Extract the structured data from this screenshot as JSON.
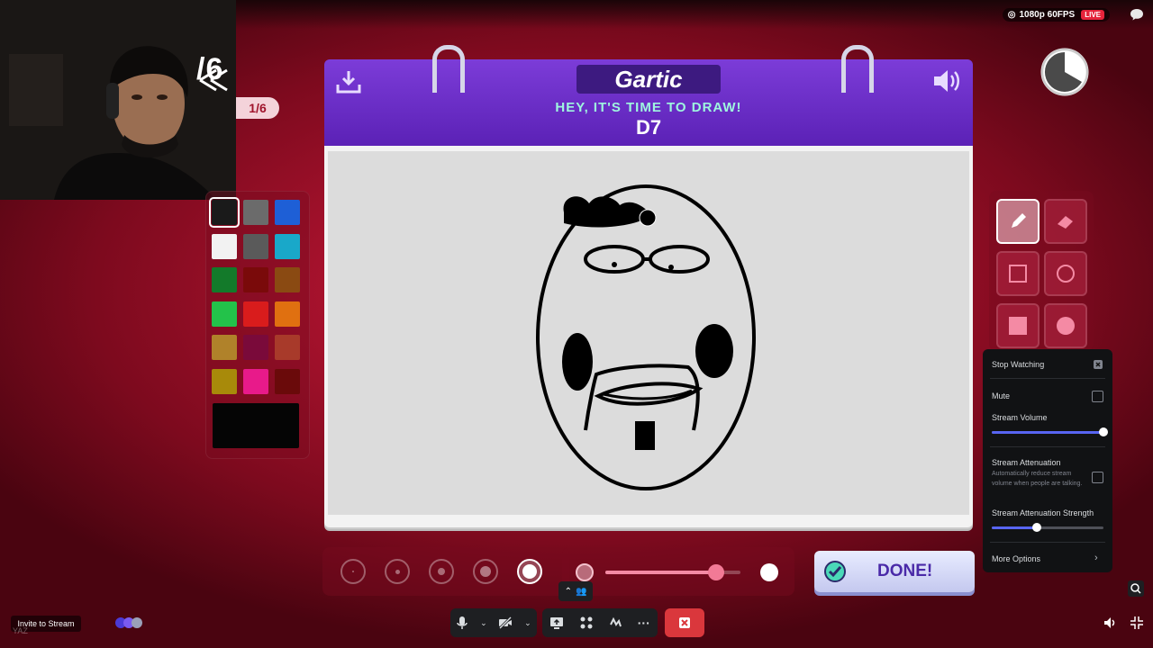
{
  "stream": {
    "quality": "1080p 60FPS",
    "live_badge": "LIVE"
  },
  "game": {
    "round_big": "/6",
    "round_pill": "1/6",
    "logo": "Gartic",
    "prompt": "HEY, IT'S TIME TO DRAW!",
    "word": "D7",
    "done_label": "DONE!",
    "timer_fraction_elapsed": 0.33,
    "selected_tool": "pencil",
    "selected_brush_size": 5,
    "opacity_level": 0.82,
    "selected_color": "#050505",
    "palette": [
      "#1a1a1a",
      "#6b6b6b",
      "#1e5fd6",
      "#f2f2f2",
      "#5a5a5a",
      "#19a8c9",
      "#137a2a",
      "#7a0a0a",
      "#8a4a12",
      "#23c24a",
      "#d91c1c",
      "#e07010",
      "#b0822a",
      "#7a0a3a",
      "#a83a2a",
      "#a88a0a",
      "#e81a8a",
      "#6a0a0a"
    ],
    "tools": [
      "pencil",
      "eraser",
      "rectangle",
      "ellipse",
      "filled-rectangle",
      "filled-ellipse"
    ]
  },
  "popup": {
    "stop_watching": "Stop Watching",
    "mute": "Mute",
    "stream_volume": "Stream Volume",
    "stream_volume_level": 1.0,
    "attenuation": "Stream Attenuation",
    "attenuation_desc": "Automatically reduce stream volume when people are talking.",
    "attenuation_strength": "Stream Attenuation Strength",
    "attenuation_strength_level": 0.4,
    "more_options": "More Options"
  },
  "bottom": {
    "invite": "Invite to Stream",
    "username": "YAZ"
  },
  "colors": {
    "accent": "#5865f2",
    "board_purple": "#6b2bd0",
    "end_call": "#da373c"
  }
}
